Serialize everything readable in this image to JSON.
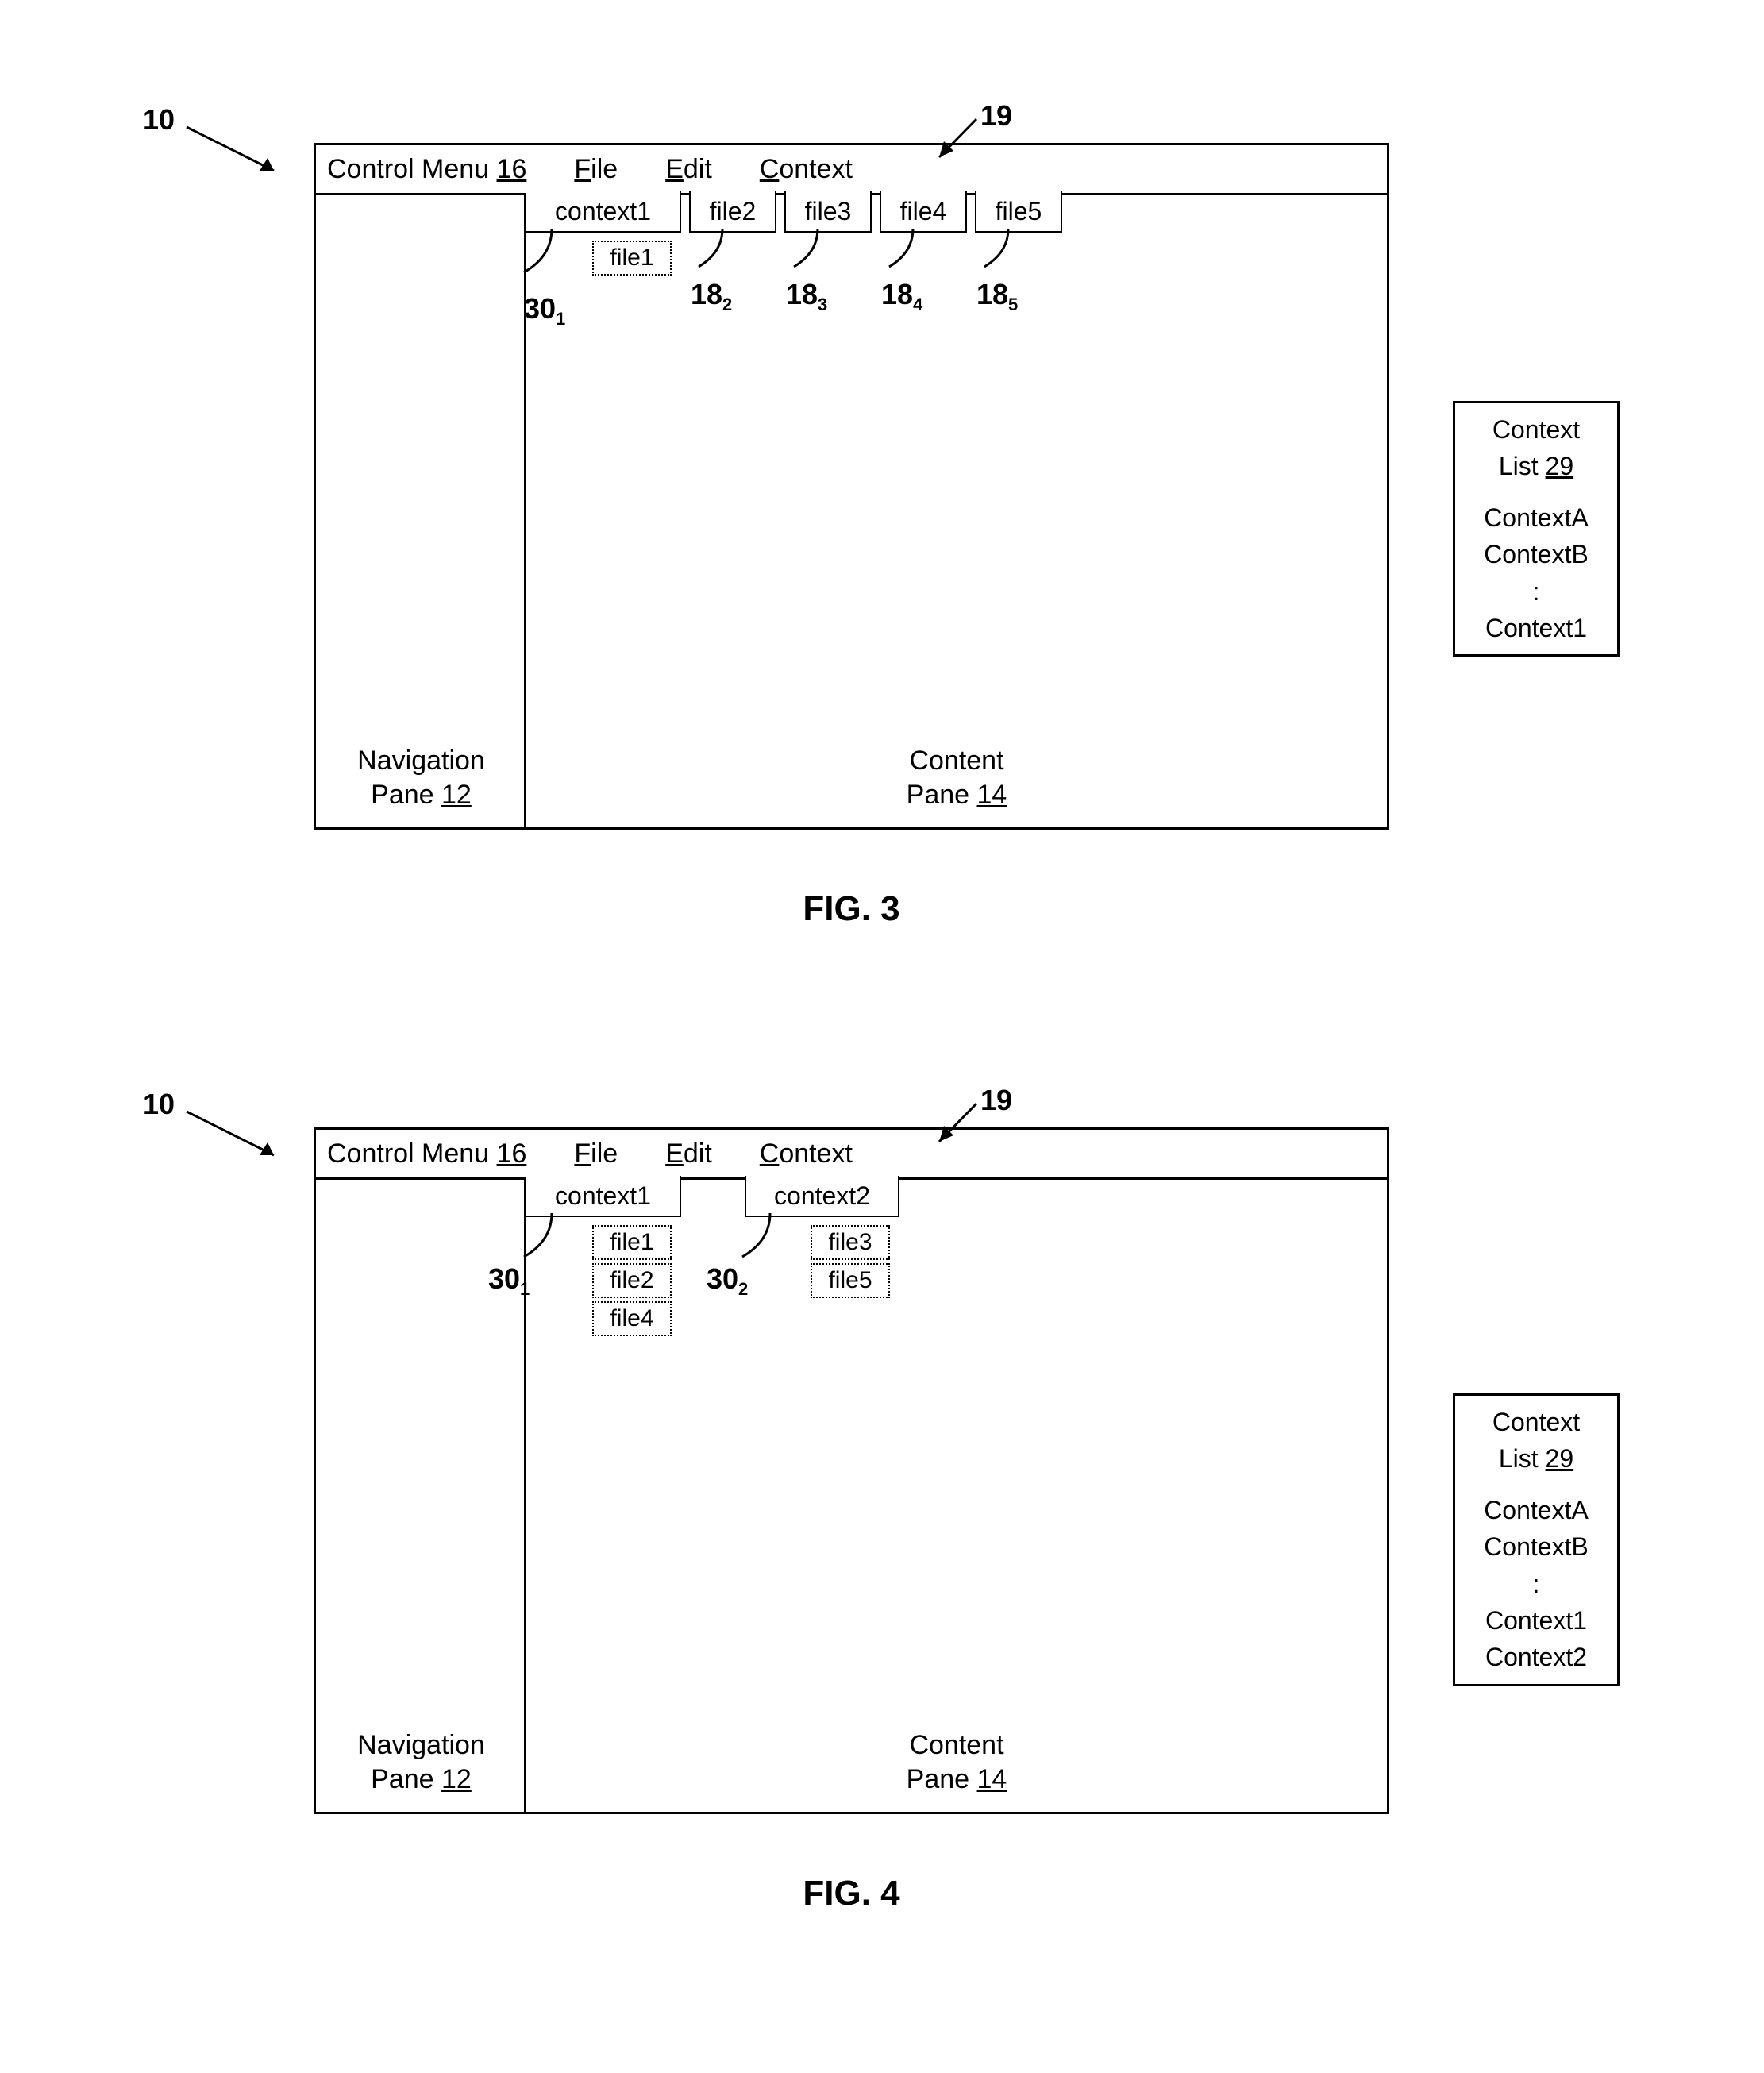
{
  "fig3": {
    "ref10": "10",
    "ref19": "19",
    "menubar": {
      "title": "Control Menu ",
      "title_ref": "16",
      "items": [
        "File",
        "Edit",
        "Context"
      ]
    },
    "tabs": {
      "context1": "context1",
      "file1": "file1",
      "file2": "file2",
      "file3": "file3",
      "file4": "file4",
      "file5": "file5"
    },
    "refs": {
      "r30_1": "30",
      "r30_1_sub": "1",
      "r18_2": "18",
      "r18_2_sub": "2",
      "r18_3": "18",
      "r18_3_sub": "3",
      "r18_4": "18",
      "r18_4_sub": "4",
      "r18_5": "18",
      "r18_5_sub": "5"
    },
    "nav_label_line1": "Navigation",
    "nav_label_line2": "Pane ",
    "nav_ref": "12",
    "content_label_line1": "Content",
    "content_label_line2": "Pane ",
    "content_ref": "14",
    "sidebox": {
      "title": "Context",
      "title2": "List ",
      "ref": "29",
      "items": [
        "ContextA",
        "ContextB",
        ":",
        "Context1"
      ]
    },
    "figlabel": "FIG. 3"
  },
  "fig4": {
    "ref10": "10",
    "ref19": "19",
    "menubar": {
      "title": "Control Menu ",
      "title_ref": "16",
      "items": [
        "File",
        "Edit",
        "Context"
      ]
    },
    "tabs": {
      "context1": "context1",
      "context2": "context2",
      "c1_files": [
        "file1",
        "file2",
        "file4"
      ],
      "c2_files": [
        "file3",
        "file5"
      ]
    },
    "refs": {
      "r30_1": "30",
      "r30_1_sub": "1",
      "r30_2": "30",
      "r30_2_sub": "2"
    },
    "nav_label_line1": "Navigation",
    "nav_label_line2": "Pane ",
    "nav_ref": "12",
    "content_label_line1": "Content",
    "content_label_line2": "Pane ",
    "content_ref": "14",
    "sidebox": {
      "title": "Context",
      "title2": "List ",
      "ref": "29",
      "items": [
        "ContextA",
        "ContextB",
        ":",
        "Context1",
        "Context2"
      ]
    },
    "figlabel": "FIG. 4"
  }
}
